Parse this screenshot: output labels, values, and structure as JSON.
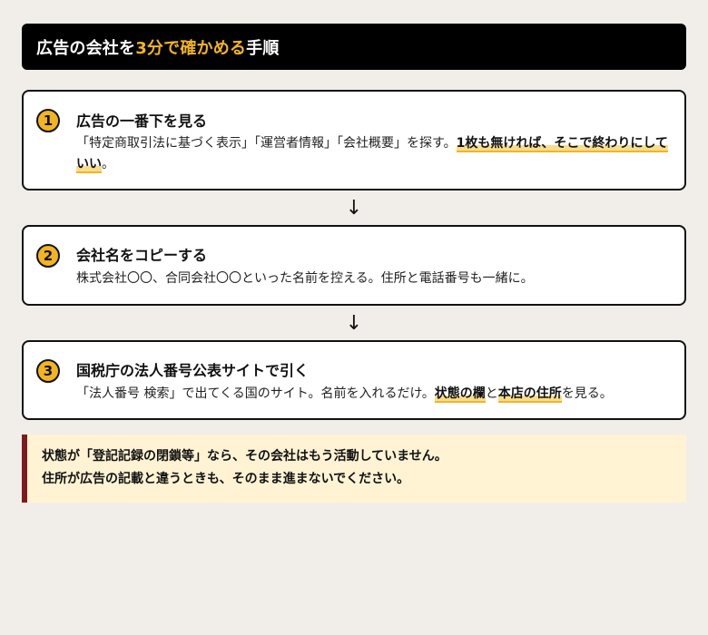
{
  "header": {
    "title_part1": "広告の会社を",
    "title_highlight": "3分で確かめる",
    "title_part2": "手順",
    "accent_color": "#f2b521"
  },
  "steps": [
    {
      "number": "1",
      "title": "広告の一番下を見る",
      "desc_text": "「特定商取引法に基づく表示」「運営者情報」「会社概要」を探す。",
      "desc_mark": "1枚も無ければ、そこで終わりにしていい",
      "desc_end": "。"
    },
    {
      "number": "2",
      "title": "会社名をコピーする",
      "desc_text": "株式会社〇〇、合同会社〇〇といった名前を控える。住所と電話番号も一緒に。"
    },
    {
      "number": "3",
      "title": "国税庁の法人番号公表サイトで引く",
      "desc_text": "「法人番号 検索」で出てくる国のサイト。名前を入れるだけ。",
      "desc_mark1": "状態の欄",
      "desc_mid": "と",
      "desc_mark2": "本店の住所",
      "desc_end": "を見る。"
    }
  ],
  "arrow_glyph": "↓",
  "warning": {
    "line1": "状態が「登記記録の閉鎖等」なら、その会社はもう活動していません。",
    "line2": "住所が広告の記載と違うときも、そのまま進まないでください。",
    "border_color": "#7d1a1e"
  }
}
